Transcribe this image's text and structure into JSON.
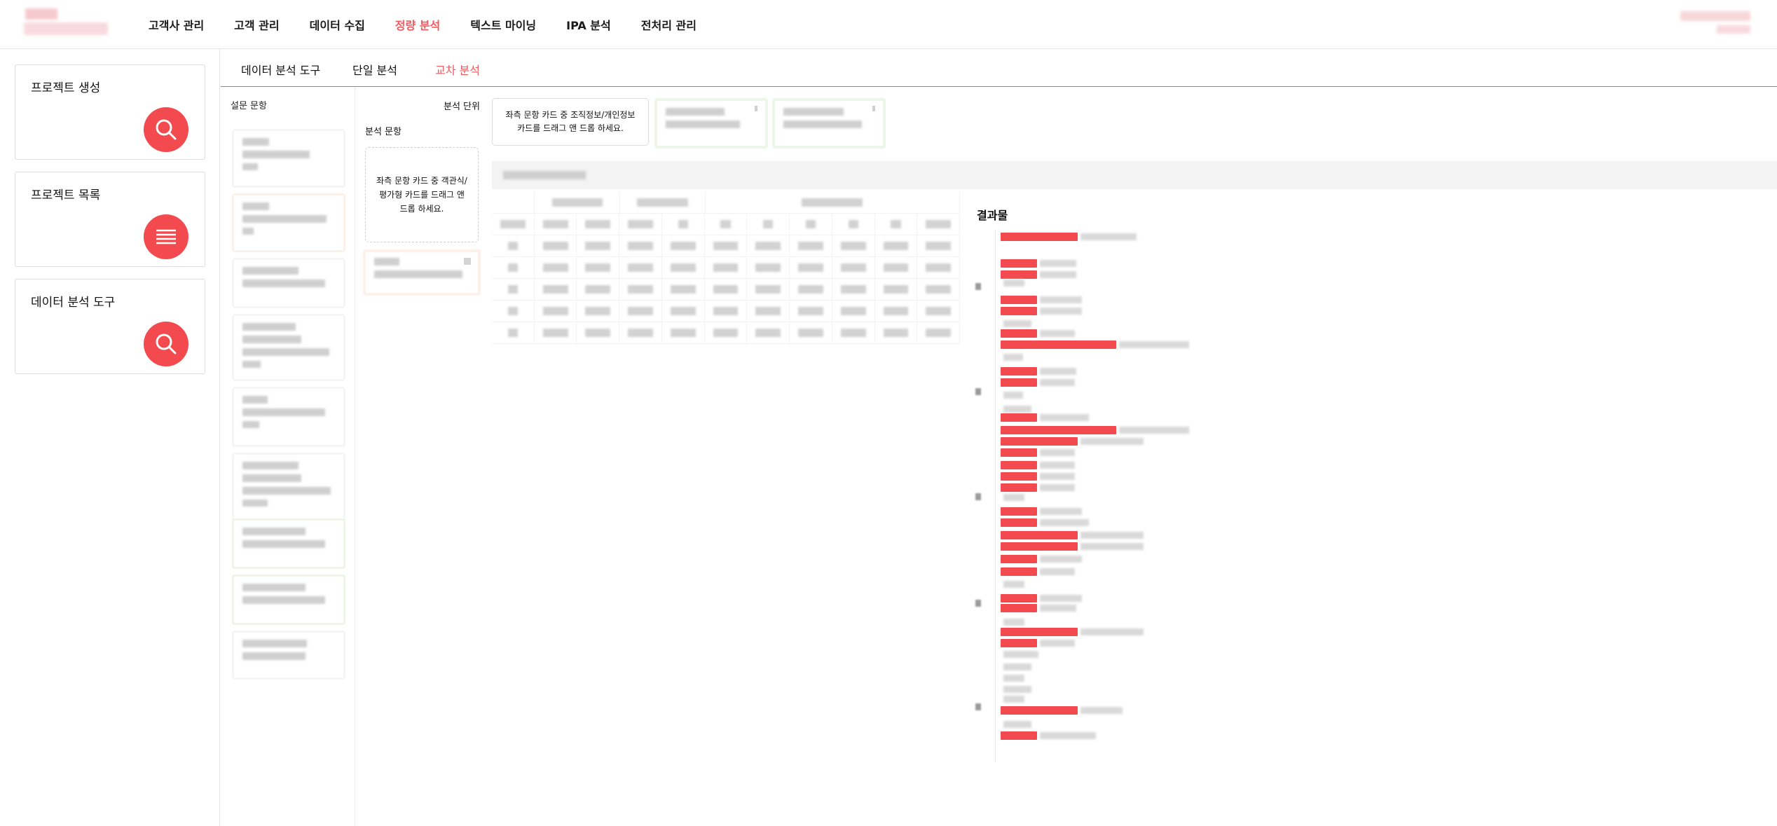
{
  "nav": {
    "items": [
      {
        "label": "고객사 관리",
        "active": false
      },
      {
        "label": "고객 관리",
        "active": false
      },
      {
        "label": "데이터 수집",
        "active": false
      },
      {
        "label": "정량 분석",
        "active": true
      },
      {
        "label": "텍스트 마이닝",
        "active": false
      },
      {
        "label": "IPA 분석",
        "active": false
      },
      {
        "label": "전처리 관리",
        "active": false
      }
    ]
  },
  "sidebar": {
    "cards": [
      {
        "title": "프로젝트 생성",
        "icon": "search-icon"
      },
      {
        "title": "프로젝트 목록",
        "icon": "list-icon"
      },
      {
        "title": "데이터 분석 도구",
        "icon": "search-icon"
      }
    ]
  },
  "subtabs": [
    {
      "label": "데이터 분석 도구",
      "active": false
    },
    {
      "label": "단일 분석",
      "active": false
    },
    {
      "label": "교차 분석",
      "active": true
    }
  ],
  "survey": {
    "heading": "설문 문항"
  },
  "analysis": {
    "unit_label": "분석 단위",
    "item_label": "분석 문항",
    "unit_drop_hint": "좌측 문항 카드 중 조직정보/개인정보 카드를 드래그 앤 드롭 하세요.",
    "item_drop_hint": "좌측 문항 카드 중 객관식/평가형 카드를 드래그 앤 드롭 하세요."
  },
  "results": {
    "title": "결과물"
  },
  "colors": {
    "accent": "#f25a5f",
    "fab": "#f24a4e",
    "bar": "#f24a4e"
  }
}
